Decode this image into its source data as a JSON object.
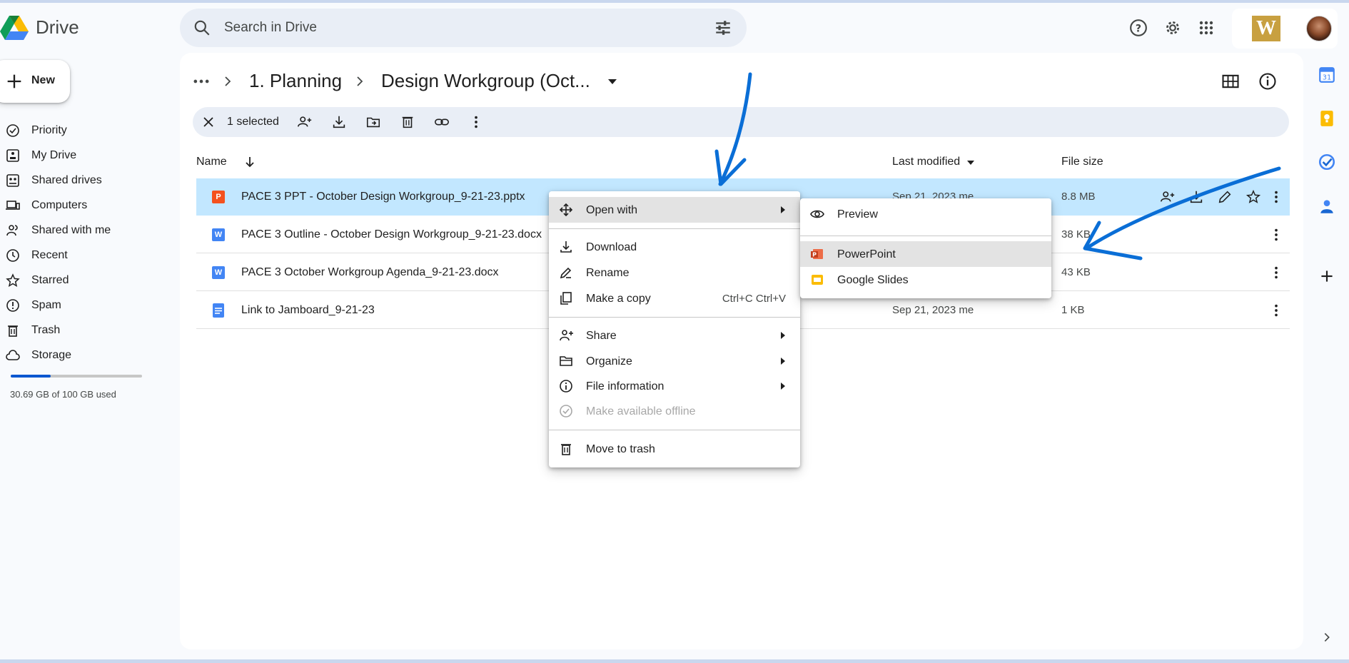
{
  "app": {
    "title": "Drive",
    "search_placeholder": "Search in Drive"
  },
  "sidebar": {
    "new_label": "New",
    "items": [
      {
        "label": "Priority",
        "icon": "priority-icon"
      },
      {
        "label": "My Drive",
        "icon": "my-drive-icon"
      },
      {
        "label": "Shared drives",
        "icon": "shared-drives-icon"
      },
      {
        "label": "Computers",
        "icon": "computers-icon"
      },
      {
        "label": "Shared with me",
        "icon": "shared-with-me-icon"
      },
      {
        "label": "Recent",
        "icon": "clock-icon"
      },
      {
        "label": "Starred",
        "icon": "star-icon"
      },
      {
        "label": "Spam",
        "icon": "spam-icon"
      },
      {
        "label": "Trash",
        "icon": "trash-icon"
      },
      {
        "label": "Storage",
        "icon": "cloud-icon"
      }
    ],
    "storage_used_fraction": 0.3069,
    "storage_text": "30.69 GB of 100 GB used"
  },
  "breadcrumb": {
    "items": [
      "1. Planning",
      "Design Workgroup (Oct..."
    ]
  },
  "selection_bar": {
    "count_label": "1 selected"
  },
  "columns": {
    "name": "Name",
    "last_modified": "Last modified",
    "file_size": "File size"
  },
  "files": [
    {
      "name": "PACE 3 PPT - October Design Workgroup_9-21-23.pptx",
      "type": "P",
      "type_color": "#f4511e",
      "modified": "Sep 21, 2023 me",
      "size": "8.8 MB",
      "selected": true
    },
    {
      "name": "PACE 3 Outline - October Design Workgroup_9-21-23.docx",
      "type": "W",
      "type_color": "#4285f4",
      "modified": "",
      "size": "38 KB",
      "selected": false
    },
    {
      "name": "PACE 3 October Workgroup Agenda_9-21-23.docx",
      "type": "W",
      "type_color": "#4285f4",
      "modified": "",
      "size": "43 KB",
      "selected": false
    },
    {
      "name": "Link to Jamboard_9-21-23",
      "type": "",
      "type_color": "#4285f4",
      "modified": "Sep 21, 2023 me",
      "size": "1 KB",
      "selected": false
    }
  ],
  "context_menu": {
    "items": [
      {
        "label": "Open with",
        "icon": "open-with-icon",
        "submenu": true,
        "highlighted": true
      },
      {
        "label": "Download",
        "icon": "download-icon"
      },
      {
        "label": "Rename",
        "icon": "rename-icon"
      },
      {
        "label": "Make a copy",
        "icon": "copy-icon",
        "shortcut": "Ctrl+C Ctrl+V"
      },
      {
        "label": "Share",
        "icon": "share-icon",
        "submenu": true
      },
      {
        "label": "Organize",
        "icon": "folder-icon",
        "submenu": true
      },
      {
        "label": "File information",
        "icon": "info-icon",
        "submenu": true
      },
      {
        "label": "Make available offline",
        "icon": "offline-icon",
        "disabled": true
      },
      {
        "label": "Move to trash",
        "icon": "trash-icon"
      }
    ]
  },
  "open_with_submenu": {
    "items": [
      {
        "label": "Preview",
        "icon": "eye-icon"
      },
      {
        "label": "PowerPoint",
        "icon": "powerpoint-icon",
        "highlighted": true
      },
      {
        "label": "Google Slides",
        "icon": "google-slides-icon"
      }
    ]
  },
  "colors": {
    "accent": "#0b57d0",
    "selected_row": "#c2e7ff",
    "annotation": "#0a6ed6"
  }
}
